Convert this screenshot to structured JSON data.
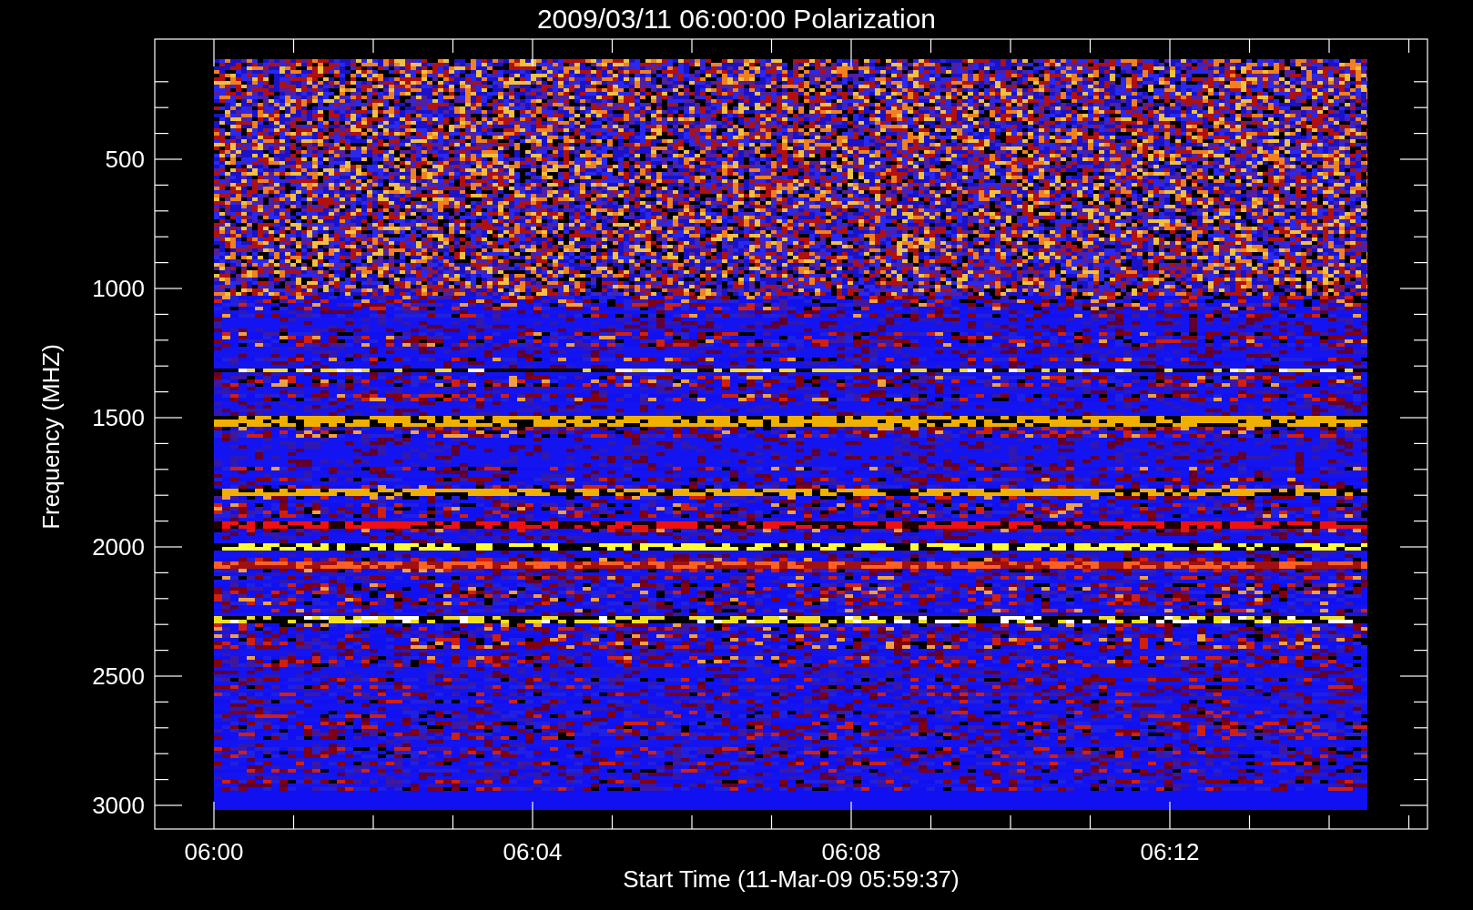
{
  "title": "2009/03/11 06:00:00 Polarization",
  "y_axis": {
    "label": "Frequency (MHZ)",
    "ticks": [
      "500",
      "1000",
      "1500",
      "2000",
      "2500",
      "3000"
    ]
  },
  "x_axis": {
    "label": "Start Time (11-Mar-09 05:59:37)",
    "ticks": [
      "06:00",
      "06:04",
      "06:08",
      "06:12"
    ]
  }
}
